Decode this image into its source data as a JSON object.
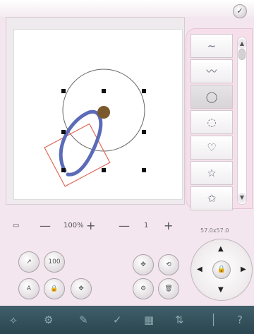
{
  "toolbar": {
    "confirm_icon": "checkmark-icon",
    "confirm_glyph": "✓"
  },
  "stitches": {
    "items": [
      {
        "label": "~",
        "icon": "straight-stitch-icon"
      },
      {
        "label": "〰",
        "icon": "wave-stitch-icon"
      },
      {
        "label": "◯",
        "icon": "oval-shape-icon",
        "selected": true
      },
      {
        "label": "◌",
        "icon": "circle-shape-icon"
      },
      {
        "label": "♡",
        "icon": "heart-shape-icon"
      },
      {
        "label": "☆",
        "icon": "star-shape-icon"
      },
      {
        "label": "✩",
        "icon": "star-outline-icon"
      }
    ],
    "scroll_up": "▲",
    "scroll_down": "▼"
  },
  "zoom": {
    "minus": "—",
    "value": "100%",
    "plus": "+"
  },
  "page": {
    "minus": "—",
    "value": "1",
    "plus": "+"
  },
  "size_label": "57.0x57.0",
  "buttons": {
    "stitch_btn": "↗",
    "hundred_btn": "100",
    "color_btn": "A",
    "lock_btn": "🔒",
    "move_btn": "✥",
    "rotate_btn": "⟲",
    "settings_btn": "⚙",
    "delete_btn": "🗑",
    "center_lock": "🔒",
    "up_arrow": "▲",
    "down_arrow": "▼",
    "left_arrow": "◀",
    "right_arrow": "▶"
  },
  "taskbar": [
    {
      "glyph": "⟡",
      "icon": "home-icon"
    },
    {
      "glyph": "⚙",
      "icon": "settings-icon"
    },
    {
      "glyph": "✎",
      "icon": "edit-icon"
    },
    {
      "glyph": "✓",
      "icon": "check-icon"
    },
    {
      "glyph": "▦",
      "icon": "grid-icon"
    },
    {
      "glyph": "⇅",
      "icon": "sort-icon"
    },
    {
      "glyph": "│",
      "icon": "bar-icon"
    },
    {
      "glyph": "?",
      "icon": "help-icon"
    }
  ],
  "colors": {
    "stitch_blue": "#5c6bb8",
    "box_red": "#e26a5a",
    "center_brown": "#7a5a2c"
  }
}
